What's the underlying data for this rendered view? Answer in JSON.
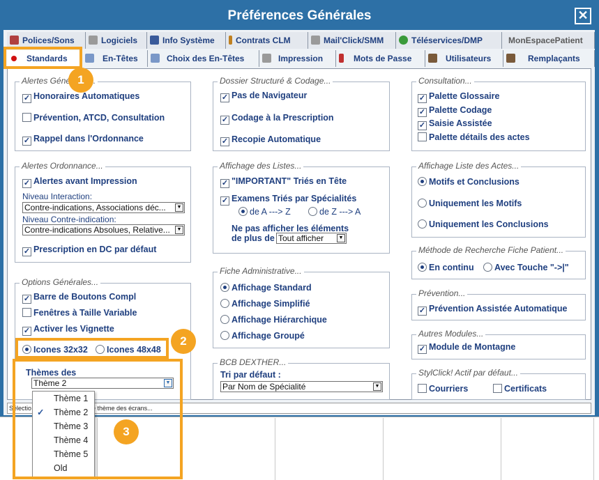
{
  "window": {
    "title": "Préférences Générales",
    "close_glyph": "✕"
  },
  "tabs_row1": [
    {
      "label": "Polices/Sons",
      "icon": "font-icon",
      "color": "#b04040"
    },
    {
      "label": "Logiciels",
      "icon": "software-icon",
      "color": "#8a8a8a"
    },
    {
      "label": "Info Système",
      "icon": "system-icon",
      "color": "#3a5a9a"
    },
    {
      "label": "Contrats CLM",
      "icon": "pencil-icon",
      "color": "#c08020"
    },
    {
      "label": "Mail'Click/SMM",
      "icon": "printer-icon",
      "color": "#8a8a8a"
    },
    {
      "label": "Téléservices/DMP",
      "icon": "leaf-icon",
      "color": "#3a9a3a"
    },
    {
      "label": "MonEspacePatient",
      "icon": "",
      "color": ""
    }
  ],
  "tabs_row2": [
    {
      "label": "Standards",
      "icon": "red-dot-icon",
      "color": "#d01010"
    },
    {
      "label": "En-Têtes",
      "icon": "header-icon",
      "color": "#5a7ab0"
    },
    {
      "label": "Choix des En-Têtes",
      "icon": "header-choice-icon",
      "color": "#5a7ab0"
    },
    {
      "label": "Impression",
      "icon": "printer-icon",
      "color": "#8a8a8a"
    },
    {
      "label": "Mots de Passe",
      "icon": "key-icon",
      "color": "#c03030"
    },
    {
      "label": "Utilisateurs",
      "icon": "user-icon",
      "color": "#7a5a3a"
    },
    {
      "label": "Remplaçants",
      "icon": "users-icon",
      "color": "#7a5a3a"
    }
  ],
  "alertes_generales": {
    "title": "Alertes Générales...",
    "honoraires": "Honoraires Automatiques",
    "prevention": "Prévention, ATCD, Consultation",
    "rappel": "Rappel dans l'Ordonnance"
  },
  "alertes_ordonnance": {
    "title": "Alertes Ordonnance...",
    "alertes_impression": "Alertes avant Impression",
    "niveau_interaction_label": "Niveau Interaction:",
    "niveau_interaction_value": "Contre-indications, Associations déc...",
    "niveau_ci_label": "Niveau Contre-indication:",
    "niveau_ci_value": "Contre-indications Absolues, Relative...",
    "prescription_dc": "Prescription en DC par défaut"
  },
  "options_generales": {
    "title": "Options Générales...",
    "barre_boutons": "Barre de Boutons Compl",
    "fenetres": "Fenêtres à Taille Variable",
    "vignette": "Activer les Vignette",
    "icones32": "Icones 32x32",
    "icones48": "Icones 48x48",
    "themes_label": "Thèmes des",
    "theme_value": "Thème 2"
  },
  "dossier_structure": {
    "title": "Dossier Structuré & Codage...",
    "navigateur": "Pas de Navigateur",
    "codage": "Codage à la Prescription",
    "recopie": "Recopie Automatique"
  },
  "affichage_listes": {
    "title": "Affichage des Listes...",
    "important": "\"IMPORTANT\" Triés en Tête",
    "examens": "Examens Triés par Spécialités",
    "az": "de A ---> Z",
    "za": "de Z ---> A",
    "ne_pas_afficher_1": "Ne pas afficher les éléments",
    "ne_pas_afficher_2": "de plus de",
    "tout_afficher": "Tout afficher"
  },
  "fiche_administrative": {
    "title": "Fiche Administrative...",
    "standard": "Affichage Standard",
    "simplifie": "Affichage Simplifié",
    "hierarchique": "Affichage Hiérarchique",
    "groupe": "Affichage Groupé"
  },
  "bcb": {
    "title": "BCB DEXTHER...",
    "tri_label": "Tri par défaut :",
    "tri_value": "Par Nom de Spécialité"
  },
  "consultation": {
    "title": "Consultation...",
    "glossaire": "Palette Glossaire",
    "codage": "Palette Codage",
    "saisie": "Saisie Assistée",
    "details": "Palette détails des actes"
  },
  "affichage_actes": {
    "title": "Affichage Liste des Actes...",
    "motifs_conclusions": "Motifs et Conclusions",
    "motifs": "Uniquement les Motifs",
    "conclusions": "Uniquement les Conclusions"
  },
  "methode_recherche": {
    "title": "Méthode de Recherche Fiche Patient...",
    "continu": "En continu",
    "touche": "Avec Touche \"->|\""
  },
  "prevention": {
    "title": "Prévention...",
    "assistee": "Prévention Assistée Automatique"
  },
  "autres_modules": {
    "title": "Autres Modules...",
    "montagne": "Module de Montagne"
  },
  "stylclick": {
    "title": "StylClick! Actif par défaut...",
    "courriers": "Courriers",
    "certificats": "Certificats"
  },
  "status": {
    "left": "Sélectio",
    "right": "de thème des écrans..."
  },
  "theme_dropdown": {
    "items": [
      "Thème 1",
      "Thème 2",
      "Thème 3",
      "Thème 4",
      "Thème 5",
      "Old"
    ],
    "selected": 1,
    "check": "✓"
  },
  "callouts": {
    "one": "1",
    "two": "2",
    "three": "3",
    "color": "#f4a422"
  }
}
